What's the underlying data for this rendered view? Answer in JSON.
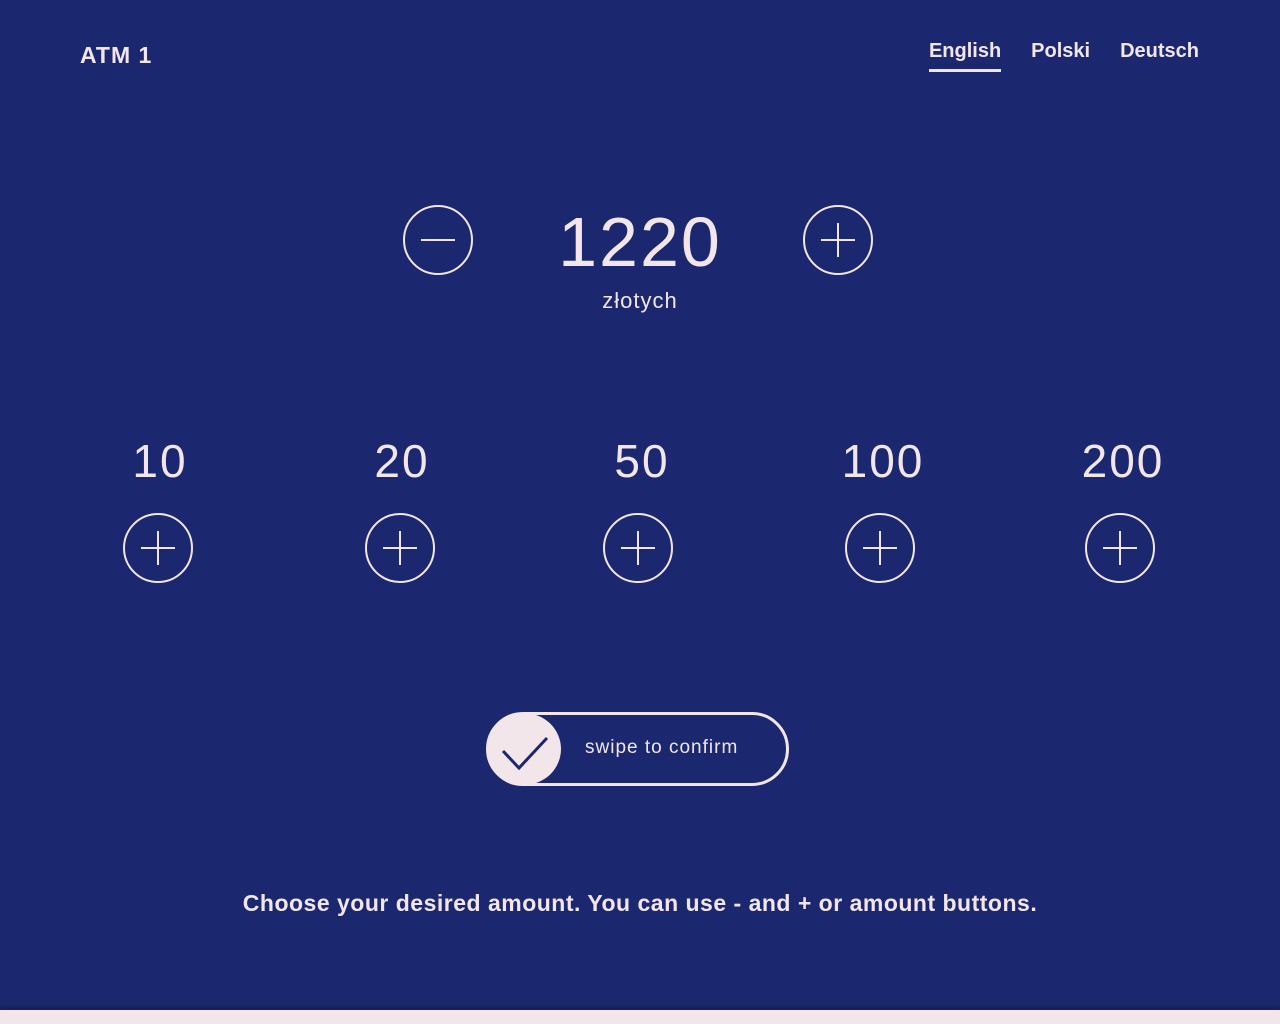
{
  "header": {
    "title": "ATM 1",
    "languages": [
      {
        "label": "English",
        "active": true
      },
      {
        "label": "Polski",
        "active": false
      },
      {
        "label": "Deutsch",
        "active": false
      }
    ]
  },
  "amount": {
    "value": "1220",
    "currency": "złotych",
    "decrement_icon": "minus-circle-icon",
    "increment_icon": "plus-circle-icon"
  },
  "denominations": [
    {
      "label": "10",
      "icon": "plus-circle-icon"
    },
    {
      "label": "20",
      "icon": "plus-circle-icon"
    },
    {
      "label": "50",
      "icon": "plus-circle-icon"
    },
    {
      "label": "100",
      "icon": "plus-circle-icon"
    },
    {
      "label": "200",
      "icon": "plus-circle-icon"
    }
  ],
  "confirm": {
    "label": "swipe to confirm",
    "icon": "checkmark-icon"
  },
  "hint": "Choose your desired amount. You can use - and + or amount buttons.",
  "colors": {
    "background": "#1b2870",
    "foreground": "#f3e6ea"
  }
}
